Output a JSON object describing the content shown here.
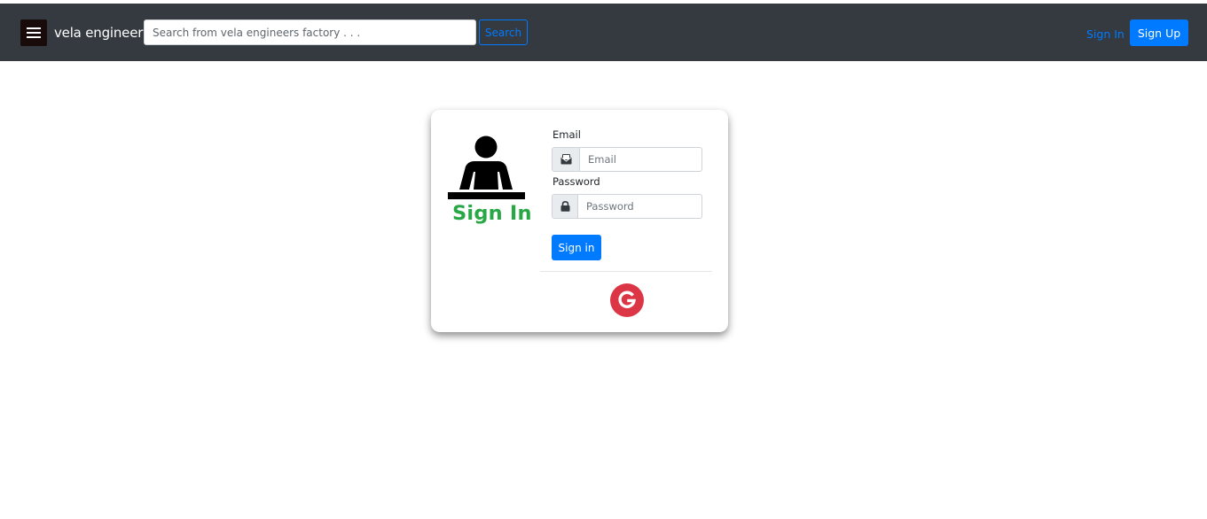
{
  "navbar": {
    "brand": "vela engineer",
    "search": {
      "placeholder": "Search from vela engineers factory . . .",
      "value": "",
      "button_label": "Search"
    },
    "signin_label": "Sign In",
    "signup_label": "Sign Up",
    "colors": {
      "background": "#343a40",
      "accent": "#007bff"
    }
  },
  "signin_card": {
    "title": "Sign In",
    "icon": "person-at-desk-icon",
    "email": {
      "label": "Email",
      "placeholder": "Email",
      "value": "",
      "icon": "envelope-icon"
    },
    "password": {
      "label": "Password",
      "placeholder": "Password",
      "value": "",
      "icon": "lock-icon"
    },
    "submit_label": "Sign in",
    "google_icon": "google-icon",
    "colors": {
      "title": "#28a745",
      "submit": "#007bff",
      "google": "#dc3545"
    }
  }
}
